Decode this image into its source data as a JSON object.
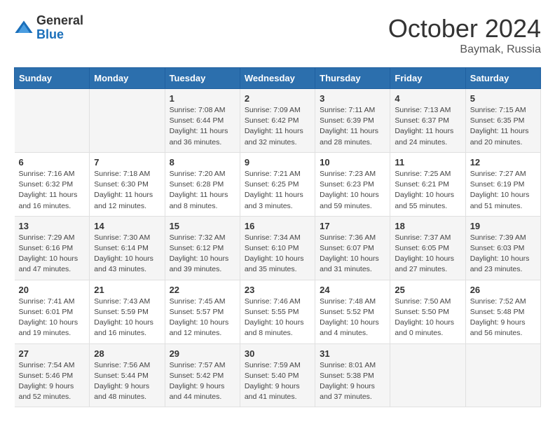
{
  "header": {
    "logo_general": "General",
    "logo_blue": "Blue",
    "month_title": "October 2024",
    "location": "Baymak, Russia"
  },
  "days_of_week": [
    "Sunday",
    "Monday",
    "Tuesday",
    "Wednesday",
    "Thursday",
    "Friday",
    "Saturday"
  ],
  "weeks": [
    [
      {
        "day": "",
        "info": ""
      },
      {
        "day": "",
        "info": ""
      },
      {
        "day": "1",
        "info": "Sunrise: 7:08 AM\nSunset: 6:44 PM\nDaylight: 11 hours and 36 minutes."
      },
      {
        "day": "2",
        "info": "Sunrise: 7:09 AM\nSunset: 6:42 PM\nDaylight: 11 hours and 32 minutes."
      },
      {
        "day": "3",
        "info": "Sunrise: 7:11 AM\nSunset: 6:39 PM\nDaylight: 11 hours and 28 minutes."
      },
      {
        "day": "4",
        "info": "Sunrise: 7:13 AM\nSunset: 6:37 PM\nDaylight: 11 hours and 24 minutes."
      },
      {
        "day": "5",
        "info": "Sunrise: 7:15 AM\nSunset: 6:35 PM\nDaylight: 11 hours and 20 minutes."
      }
    ],
    [
      {
        "day": "6",
        "info": "Sunrise: 7:16 AM\nSunset: 6:32 PM\nDaylight: 11 hours and 16 minutes."
      },
      {
        "day": "7",
        "info": "Sunrise: 7:18 AM\nSunset: 6:30 PM\nDaylight: 11 hours and 12 minutes."
      },
      {
        "day": "8",
        "info": "Sunrise: 7:20 AM\nSunset: 6:28 PM\nDaylight: 11 hours and 8 minutes."
      },
      {
        "day": "9",
        "info": "Sunrise: 7:21 AM\nSunset: 6:25 PM\nDaylight: 11 hours and 3 minutes."
      },
      {
        "day": "10",
        "info": "Sunrise: 7:23 AM\nSunset: 6:23 PM\nDaylight: 10 hours and 59 minutes."
      },
      {
        "day": "11",
        "info": "Sunrise: 7:25 AM\nSunset: 6:21 PM\nDaylight: 10 hours and 55 minutes."
      },
      {
        "day": "12",
        "info": "Sunrise: 7:27 AM\nSunset: 6:19 PM\nDaylight: 10 hours and 51 minutes."
      }
    ],
    [
      {
        "day": "13",
        "info": "Sunrise: 7:29 AM\nSunset: 6:16 PM\nDaylight: 10 hours and 47 minutes."
      },
      {
        "day": "14",
        "info": "Sunrise: 7:30 AM\nSunset: 6:14 PM\nDaylight: 10 hours and 43 minutes."
      },
      {
        "day": "15",
        "info": "Sunrise: 7:32 AM\nSunset: 6:12 PM\nDaylight: 10 hours and 39 minutes."
      },
      {
        "day": "16",
        "info": "Sunrise: 7:34 AM\nSunset: 6:10 PM\nDaylight: 10 hours and 35 minutes."
      },
      {
        "day": "17",
        "info": "Sunrise: 7:36 AM\nSunset: 6:07 PM\nDaylight: 10 hours and 31 minutes."
      },
      {
        "day": "18",
        "info": "Sunrise: 7:37 AM\nSunset: 6:05 PM\nDaylight: 10 hours and 27 minutes."
      },
      {
        "day": "19",
        "info": "Sunrise: 7:39 AM\nSunset: 6:03 PM\nDaylight: 10 hours and 23 minutes."
      }
    ],
    [
      {
        "day": "20",
        "info": "Sunrise: 7:41 AM\nSunset: 6:01 PM\nDaylight: 10 hours and 19 minutes."
      },
      {
        "day": "21",
        "info": "Sunrise: 7:43 AM\nSunset: 5:59 PM\nDaylight: 10 hours and 16 minutes."
      },
      {
        "day": "22",
        "info": "Sunrise: 7:45 AM\nSunset: 5:57 PM\nDaylight: 10 hours and 12 minutes."
      },
      {
        "day": "23",
        "info": "Sunrise: 7:46 AM\nSunset: 5:55 PM\nDaylight: 10 hours and 8 minutes."
      },
      {
        "day": "24",
        "info": "Sunrise: 7:48 AM\nSunset: 5:52 PM\nDaylight: 10 hours and 4 minutes."
      },
      {
        "day": "25",
        "info": "Sunrise: 7:50 AM\nSunset: 5:50 PM\nDaylight: 10 hours and 0 minutes."
      },
      {
        "day": "26",
        "info": "Sunrise: 7:52 AM\nSunset: 5:48 PM\nDaylight: 9 hours and 56 minutes."
      }
    ],
    [
      {
        "day": "27",
        "info": "Sunrise: 7:54 AM\nSunset: 5:46 PM\nDaylight: 9 hours and 52 minutes."
      },
      {
        "day": "28",
        "info": "Sunrise: 7:56 AM\nSunset: 5:44 PM\nDaylight: 9 hours and 48 minutes."
      },
      {
        "day": "29",
        "info": "Sunrise: 7:57 AM\nSunset: 5:42 PM\nDaylight: 9 hours and 44 minutes."
      },
      {
        "day": "30",
        "info": "Sunrise: 7:59 AM\nSunset: 5:40 PM\nDaylight: 9 hours and 41 minutes."
      },
      {
        "day": "31",
        "info": "Sunrise: 8:01 AM\nSunset: 5:38 PM\nDaylight: 9 hours and 37 minutes."
      },
      {
        "day": "",
        "info": ""
      },
      {
        "day": "",
        "info": ""
      }
    ]
  ]
}
